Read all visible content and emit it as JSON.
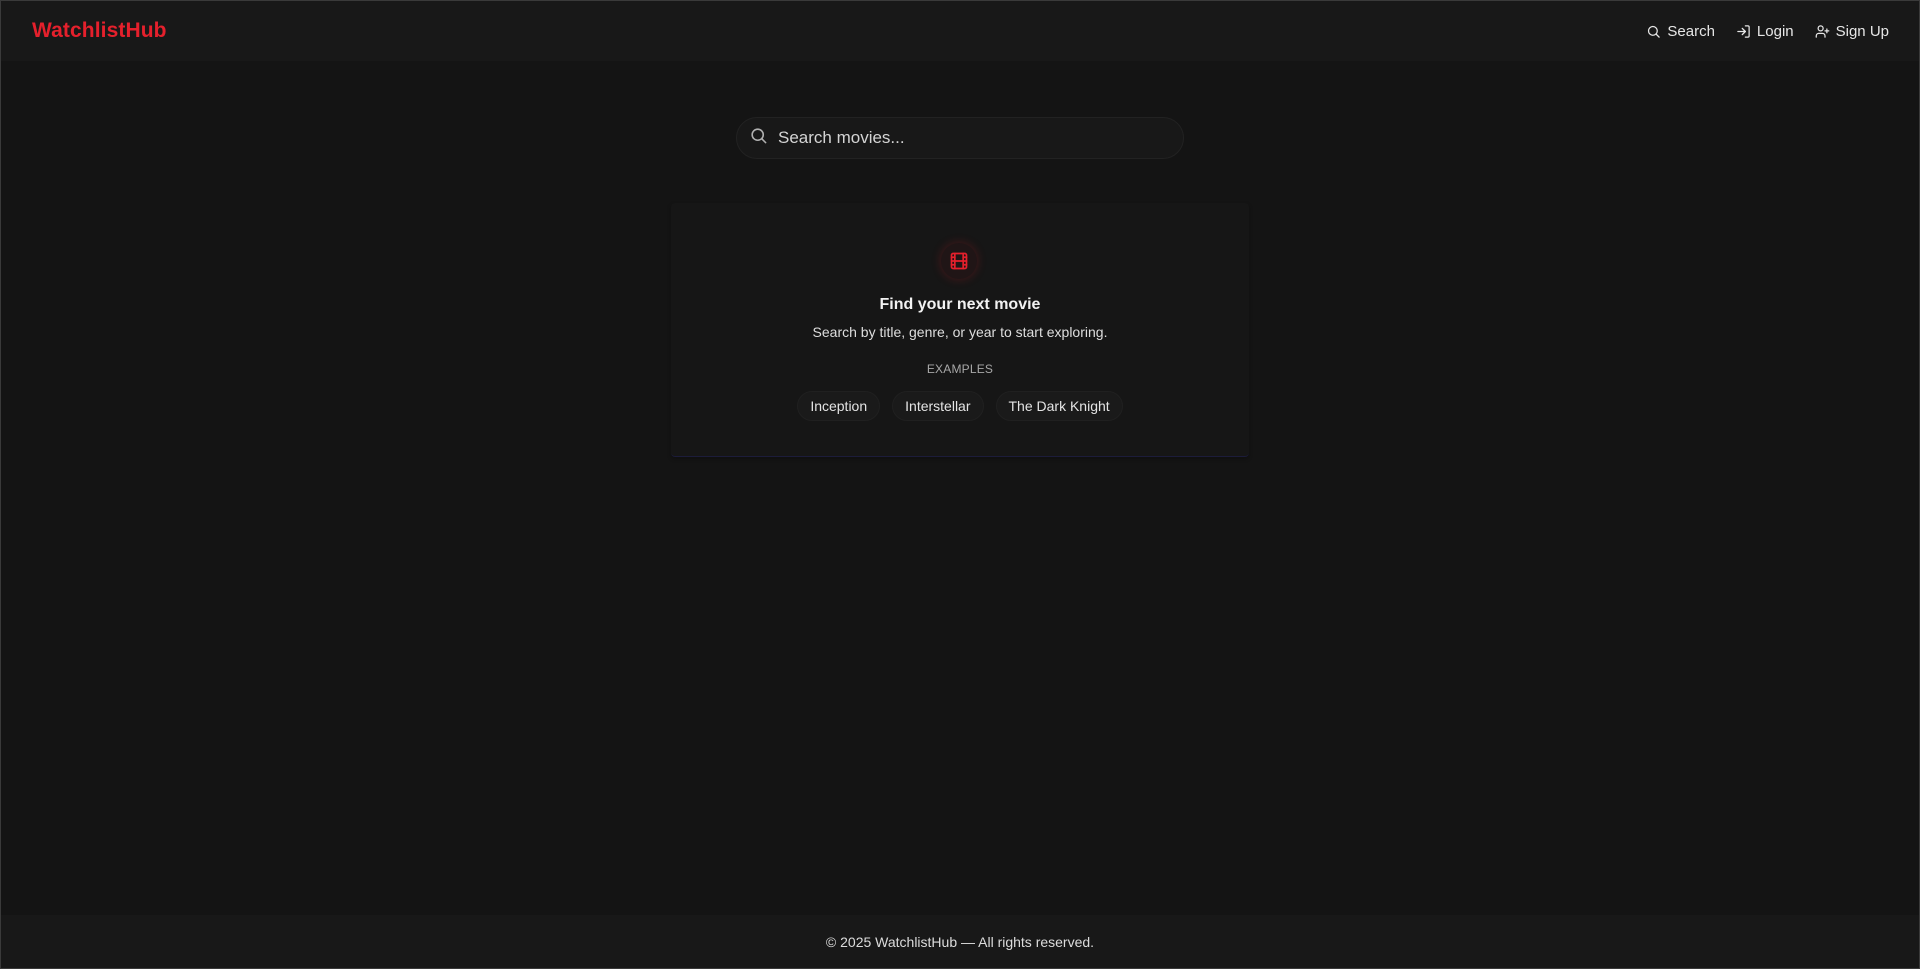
{
  "header": {
    "logo": "WatchlistHub",
    "nav": [
      {
        "label": "Search",
        "icon": "search-icon"
      },
      {
        "label": "Login",
        "icon": "login-icon"
      },
      {
        "label": "Sign Up",
        "icon": "user-plus-icon"
      }
    ]
  },
  "search": {
    "placeholder": "Search movies...",
    "value": ""
  },
  "empty_state": {
    "icon": "film-icon",
    "title": "Find your next movie",
    "subtitle": "Search by title, genre, or year to start exploring.",
    "examples_label": "EXAMPLES",
    "examples": [
      "Inception",
      "Interstellar",
      "The Dark Knight"
    ]
  },
  "footer": {
    "text": "© 2025 WatchlistHub — All rights reserved."
  },
  "colors": {
    "brand": "#e5202c",
    "background": "#141414",
    "surface": "#181818"
  }
}
